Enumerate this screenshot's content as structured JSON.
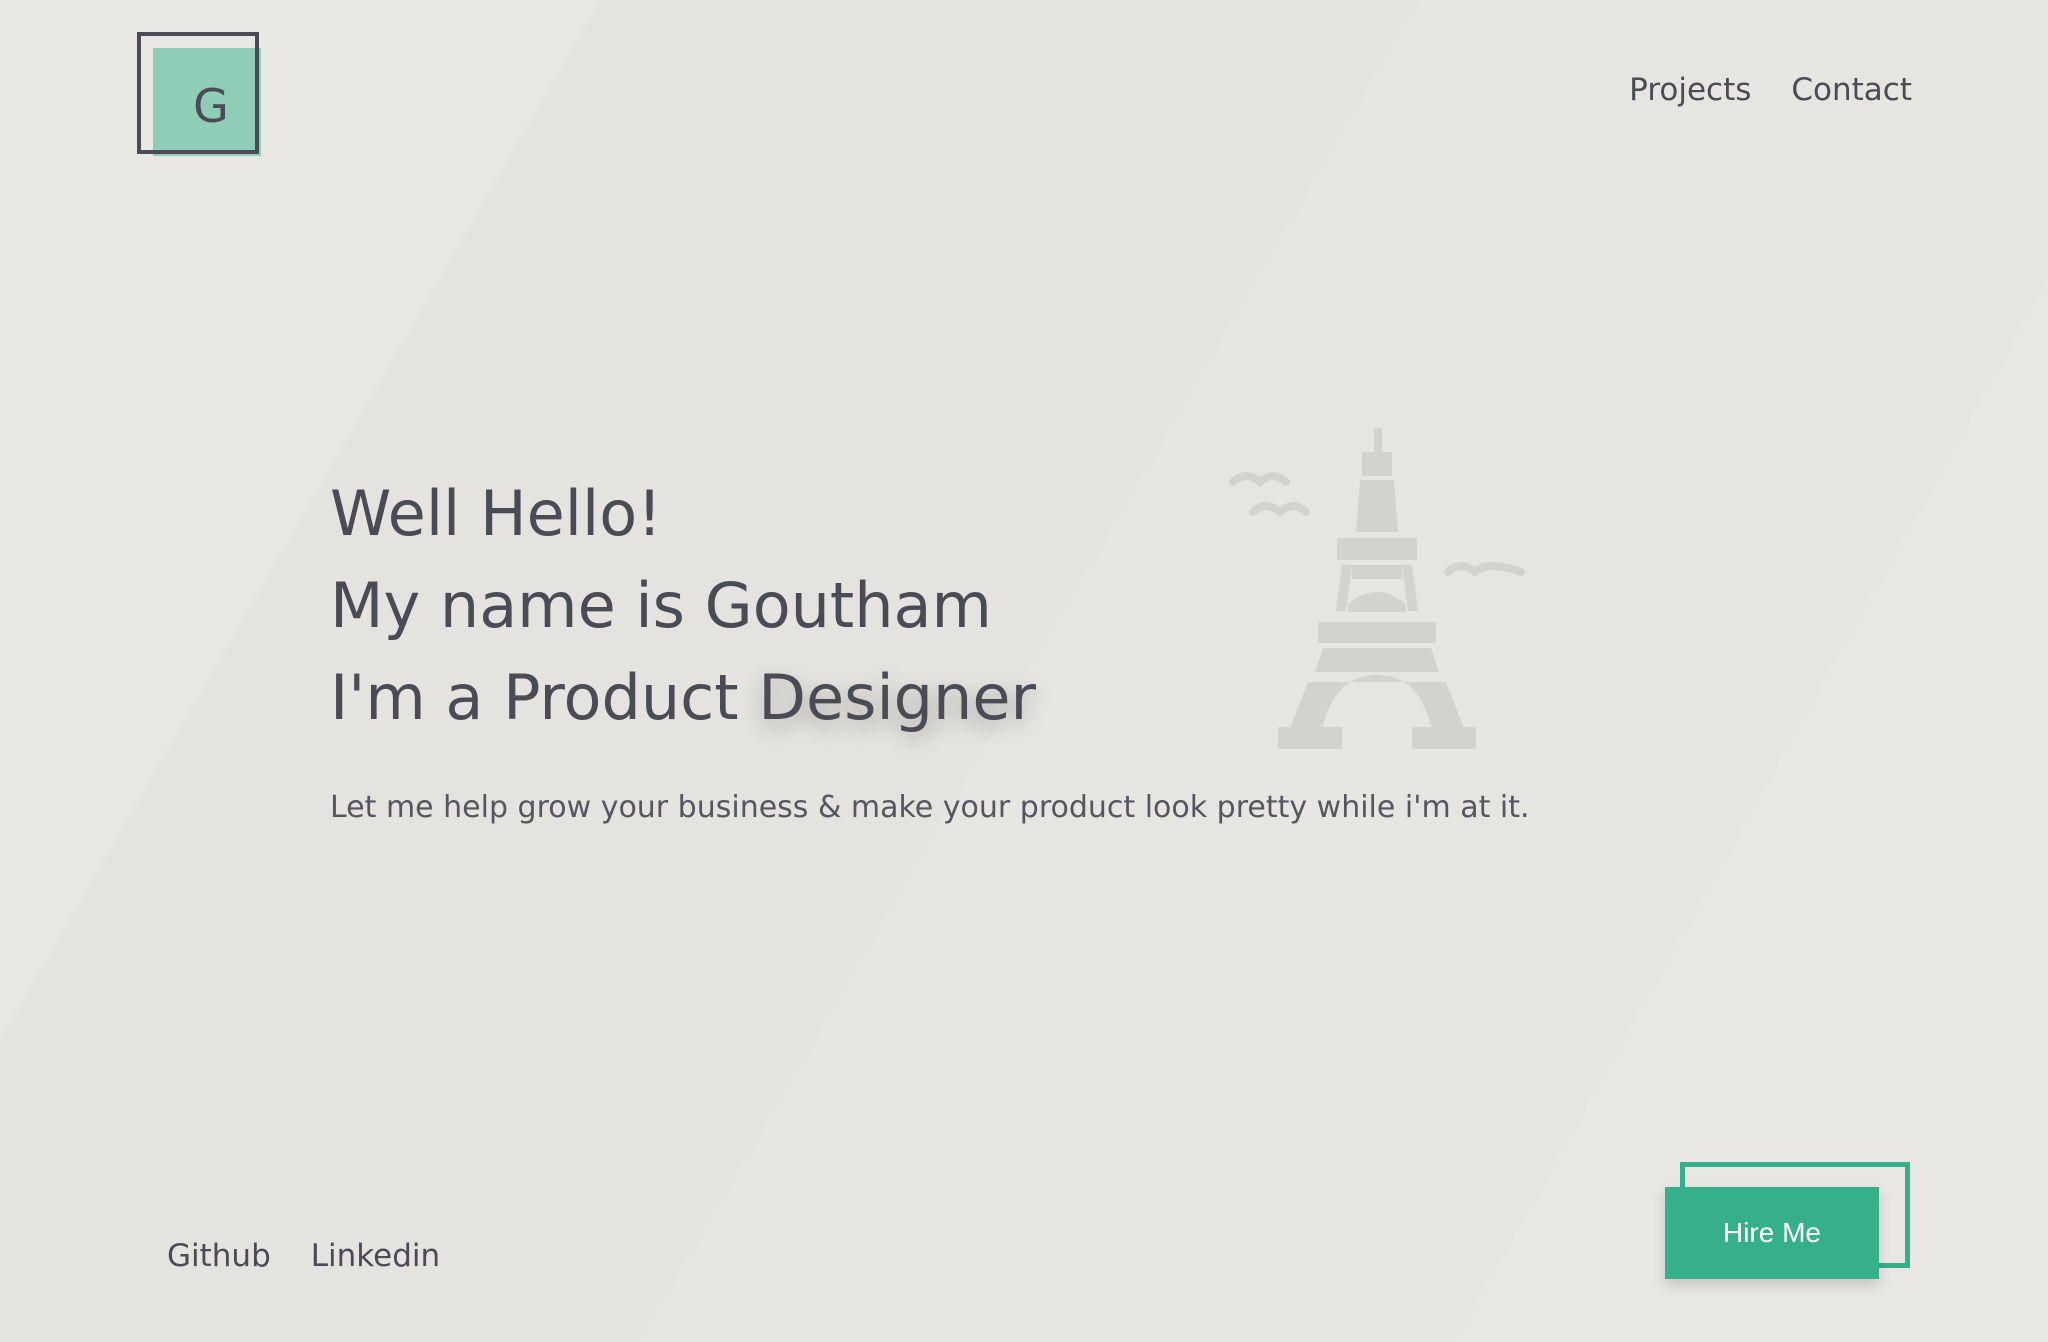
{
  "logo": {
    "letter": "G"
  },
  "nav": {
    "items": [
      "Projects",
      "Contact"
    ]
  },
  "hero": {
    "line1": "Well Hello!",
    "line2": "My name is Goutham",
    "line3_prefix": "I'm a Product ",
    "line3_highlight": "Designer"
  },
  "tagline": "Let me help grow your business & make your product look pretty while i'm at it.",
  "social": [
    "Github",
    "Linkedin"
  ],
  "cta": {
    "label": "Hire Me"
  },
  "colors": {
    "background": "#e9e7e3",
    "text": "#4a4b55",
    "accent": "#36b08a",
    "logo_fill": "#8fcdb6",
    "illustration": "#d3d2ce"
  },
  "icons": {
    "illustration": "eiffel-tower-icon"
  }
}
